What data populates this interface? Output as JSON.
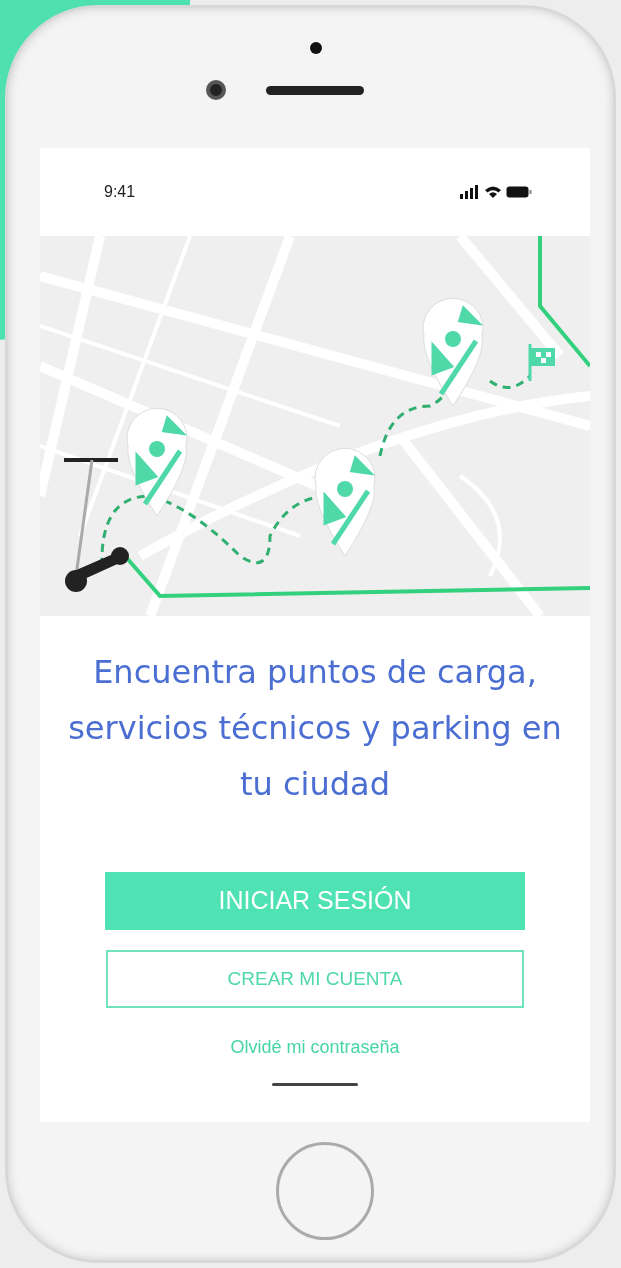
{
  "status_bar": {
    "time": "9:41"
  },
  "headline": "Encuentra puntos de carga, servicios técnicos y parking en tu ciudad",
  "buttons": [
    {
      "kind": "filled",
      "label": "INICIAR SESIÓN"
    },
    {
      "kind": "outline",
      "label": "CREAR MI CUENTA"
    },
    {
      "kind": "link",
      "label": "Olvidé mi contraseña"
    }
  ]
}
